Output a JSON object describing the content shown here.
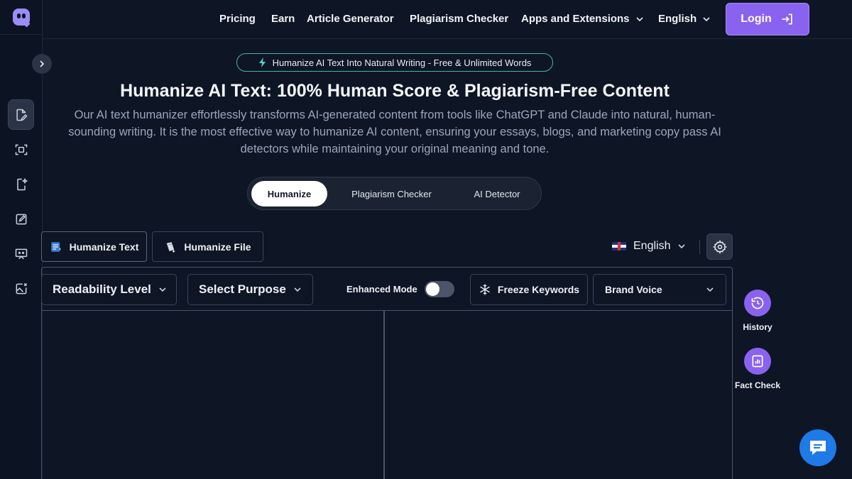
{
  "nav": {
    "items": [
      "Pricing",
      "Earn",
      "Article Generator",
      "Plagiarism Checker",
      "Apps and Extensions",
      "English"
    ],
    "login": "Login"
  },
  "hero": {
    "badge": "Humanize AI Text Into Natural Writing - Free & Unlimited Words",
    "title": "Humanize AI Text: 100% Human Score & Plagiarism-Free Content",
    "description": "Our AI text humanizer effortlessly transforms AI-generated content from tools like ChatGPT and Claude into natural, human-sounding writing. It is the most effective way to humanize AI content, ensuring your essays, blogs, and marketing copy pass AI detectors while maintaining your original meaning and tone."
  },
  "mode_tabs": [
    {
      "label": "Humanize",
      "active": true
    },
    {
      "label": "Plagiarism Checker",
      "active": false
    },
    {
      "label": "AI Detector",
      "active": false
    }
  ],
  "input_tabs": [
    {
      "label": "Humanize Text",
      "active": true
    },
    {
      "label": "Humanize File",
      "active": false
    }
  ],
  "language": "English",
  "toolbar": {
    "readability": "Readability Level",
    "purpose": "Select Purpose",
    "enhanced_mode": "Enhanced Mode",
    "enhanced_on": false,
    "freeze_keywords": "Freeze Keywords",
    "brand_voice": "Brand Voice"
  },
  "side_actions": {
    "history": "History",
    "fact_check": "Fact Check"
  },
  "colors": {
    "background": "#0e1525",
    "accent": "#8a62f0",
    "badge_border": "#3fb8a3",
    "chat": "#1d7ae6"
  }
}
